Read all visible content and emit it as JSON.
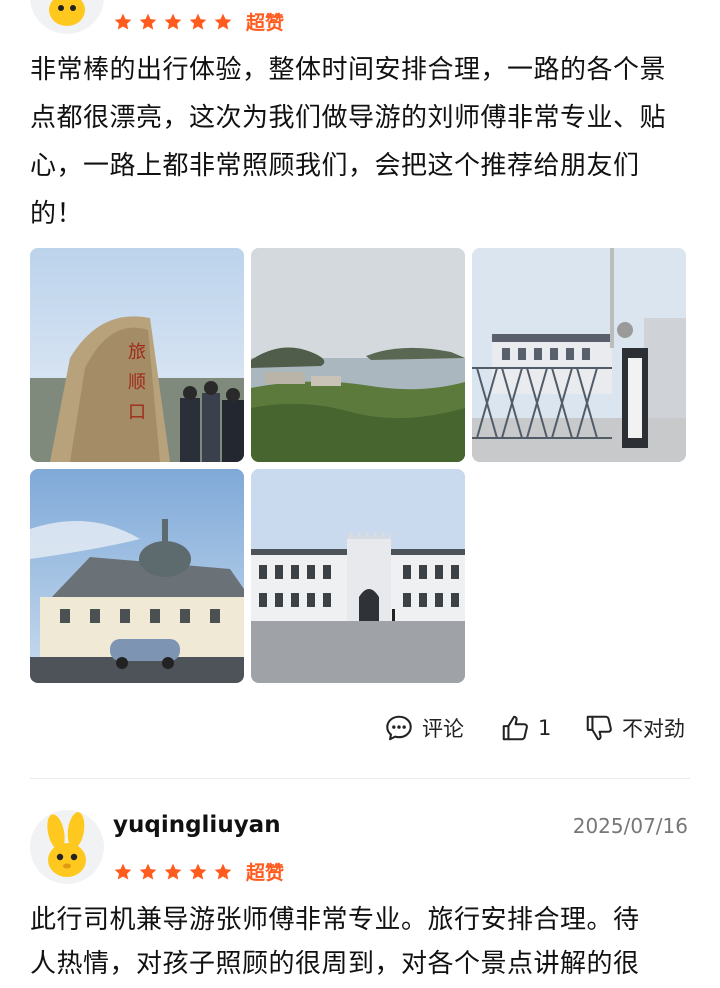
{
  "reviews": [
    {
      "avatar_icon": "mascot-rabbit-icon",
      "rating_stars": 5,
      "rating_label": "超赞",
      "text": "非常棒的出行体验，整体时间安排合理，一路的各个景点都很漂亮，这次为我们做导游的刘师傅非常专业、贴心，一路上都非常照顾我们，会把这个推荐给朋友们的！",
      "photos": [
        {
          "desc": "travel-photo-stone-marker"
        },
        {
          "desc": "travel-photo-coastal-view"
        },
        {
          "desc": "travel-photo-museum-gate"
        },
        {
          "desc": "travel-photo-domed-building"
        },
        {
          "desc": "travel-photo-prison-facade"
        }
      ],
      "actions": {
        "comment_label": "评论",
        "like_count": "1",
        "dislike_label": "不对劲"
      }
    },
    {
      "username": "yuqingliuyan",
      "date": "2025/07/16",
      "avatar_icon": "mascot-rabbit-icon",
      "rating_stars": 5,
      "rating_label": "超赞",
      "text_line1": "此行司机兼导游张师傅非常专业。旅行安排合理。待",
      "text_line2": "人热情，对孩子照顾的很周到，对各个景点讲解的很"
    }
  ],
  "colors": {
    "star": "#ff5b1f",
    "mascot": "#ffc81e"
  }
}
